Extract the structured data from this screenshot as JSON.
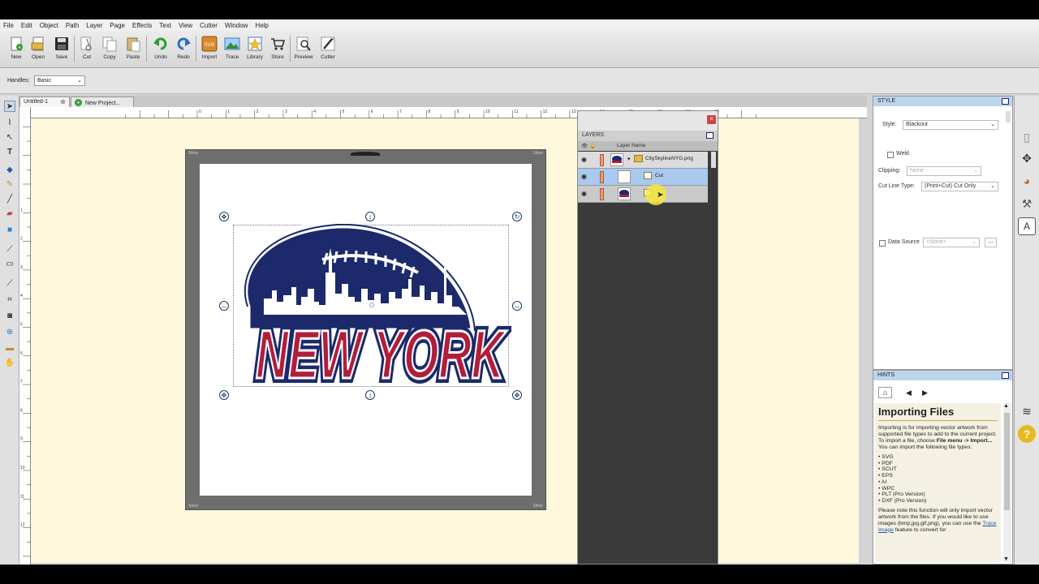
{
  "menu": [
    "File",
    "Edit",
    "Object",
    "Path",
    "Layer",
    "Page",
    "Effects",
    "Text",
    "View",
    "Cutter",
    "Window",
    "Help"
  ],
  "toolbar": [
    {
      "label": "New",
      "icon": "new-icon"
    },
    {
      "label": "Open",
      "icon": "open-icon"
    },
    {
      "label": "Save",
      "icon": "save-icon"
    },
    {
      "label": "Cut",
      "icon": "cut-icon"
    },
    {
      "label": "Copy",
      "icon": "copy-icon"
    },
    {
      "label": "Paste",
      "icon": "paste-icon"
    },
    {
      "label": "Undo",
      "icon": "undo-icon"
    },
    {
      "label": "Redo",
      "icon": "redo-icon"
    },
    {
      "label": "Import",
      "icon": "import-icon",
      "icon_text": "SVG"
    },
    {
      "label": "Trace",
      "icon": "trace-icon"
    },
    {
      "label": "Library",
      "icon": "library-icon"
    },
    {
      "label": "Store",
      "icon": "store-icon"
    },
    {
      "label": "Preview",
      "icon": "preview-icon"
    },
    {
      "label": "Cutter",
      "icon": "cutter-icon"
    }
  ],
  "handles": {
    "label": "Handles:",
    "value": "Basic"
  },
  "tabs": [
    {
      "label": "Untitled-1",
      "close": "⊗"
    },
    {
      "label": "New Project...",
      "add": "+"
    }
  ],
  "ruler": {
    "h_ticks": [
      "0",
      "1",
      "2",
      "3",
      "4",
      "5",
      "6",
      "7",
      "8",
      "9",
      "10",
      "11",
      "12",
      "13",
      "14",
      "15",
      "16",
      "17",
      "18"
    ],
    "v_ticks": [
      "1",
      "2",
      "3",
      "4",
      "5",
      "6",
      "7",
      "8",
      "9",
      "10",
      "11",
      "12"
    ]
  },
  "mat": {
    "corner_text": "Silver"
  },
  "artwork": {
    "text": "NEW YORK"
  },
  "layers": {
    "title": "LAYERS",
    "column": "Layer Name",
    "close": "×",
    "rows": [
      {
        "name": "CitySkylineNYG.png",
        "expand": "▾"
      },
      {
        "name": "Cut"
      },
      {
        "name": ""
      }
    ]
  },
  "style": {
    "title": "STYLE",
    "style_label": "Style:",
    "style_value": "Blackout",
    "weld_label": "Weld",
    "clipping_label": "Clipping:",
    "clipping_value": "None",
    "cutline_label": "Cut Line Type:",
    "cutline_value": "(Print+Cut) Cut Only",
    "datasource_label": "Data Source",
    "datasource_value": "<None>"
  },
  "hints": {
    "title": "HINTS",
    "heading": "Importing Files",
    "para1_pre": "Importing is for importing vector artwork from supported file types to add to the current project. To import a file, choose ",
    "para1_bold": "File menu -> Import...",
    "para1_post": " You can import the following file types:",
    "filetypes": [
      "SVG",
      "PDF",
      "SCUT",
      "EPS",
      "AI",
      "WPC",
      "PLT (Pro Version)",
      "DXF (Pro Version)"
    ],
    "para2_pre": "Please note this function will only import vector artwork from the files. If you would like to use images (bmp,jpg,gif,png), you can use the ",
    "para2_link": "Trace Image",
    "para2_post": " feature to convert for"
  },
  "colors": {
    "navy": "#1c2a6b",
    "red": "#b01e3a",
    "canvas_bg": "#fdf8dc",
    "selection_blue": "#a9c9ef",
    "panel_title": "#bcd5ec"
  }
}
